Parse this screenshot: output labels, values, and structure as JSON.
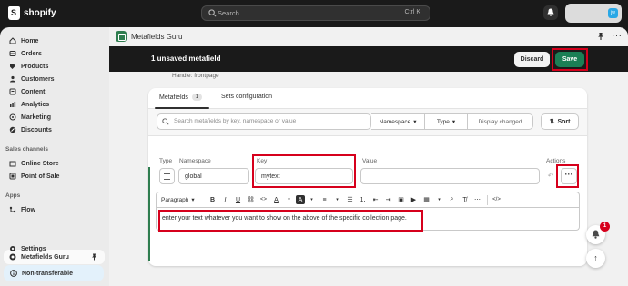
{
  "topbar": {
    "brand": "shopify",
    "search_placeholder": "Search",
    "search_shortcut": "Ctrl K",
    "avatar_initials": "jw"
  },
  "sidebar": {
    "items": [
      {
        "label": "Home",
        "icon": "home-icon"
      },
      {
        "label": "Orders",
        "icon": "orders-icon"
      },
      {
        "label": "Products",
        "icon": "tag-icon"
      },
      {
        "label": "Customers",
        "icon": "person-icon"
      },
      {
        "label": "Content",
        "icon": "content-icon"
      },
      {
        "label": "Analytics",
        "icon": "analytics-icon"
      },
      {
        "label": "Marketing",
        "icon": "target-icon"
      },
      {
        "label": "Discounts",
        "icon": "discount-icon"
      }
    ],
    "sales_channels_heading": "Sales channels",
    "sales_channels": [
      {
        "label": "Online Store",
        "icon": "store-icon"
      },
      {
        "label": "Point of Sale",
        "icon": "pos-icon"
      }
    ],
    "apps_heading": "Apps",
    "apps": [
      {
        "label": "Flow",
        "icon": "flow-icon"
      }
    ],
    "active_app": "Metafields Guru",
    "settings_label": "Settings",
    "non_transferable_label": "Non-transferable"
  },
  "app": {
    "title": "Metafields Guru",
    "savebar_text": "1 unsaved metafield",
    "discard_label": "Discard",
    "save_label": "Save",
    "handle_text": "Handle: frontpage"
  },
  "card": {
    "tabs": [
      {
        "label": "Metafields",
        "count": "1"
      },
      {
        "label": "Sets configuration"
      }
    ],
    "filter_placeholder": "Search metafields by key, namespace or value",
    "namespace_btn": "Namespace",
    "type_btn": "Type",
    "display_changed_btn": "Display changed",
    "sort_btn": "Sort",
    "columns": {
      "type": "Type",
      "namespace": "Namespace",
      "key": "Key",
      "value": "Value",
      "actions": "Actions"
    },
    "row": {
      "namespace": "global",
      "key": "mytext",
      "more": "···"
    },
    "toolbar_paragraph": "Paragraph",
    "editor_text": "enter your text whatever you want to show on the above of the specific collection page."
  },
  "floating": {
    "notification_count": "1"
  },
  "colors": {
    "brand_green": "#1a7f55",
    "highlight_red": "#d6001c",
    "topbar": "#1a1a1a"
  }
}
